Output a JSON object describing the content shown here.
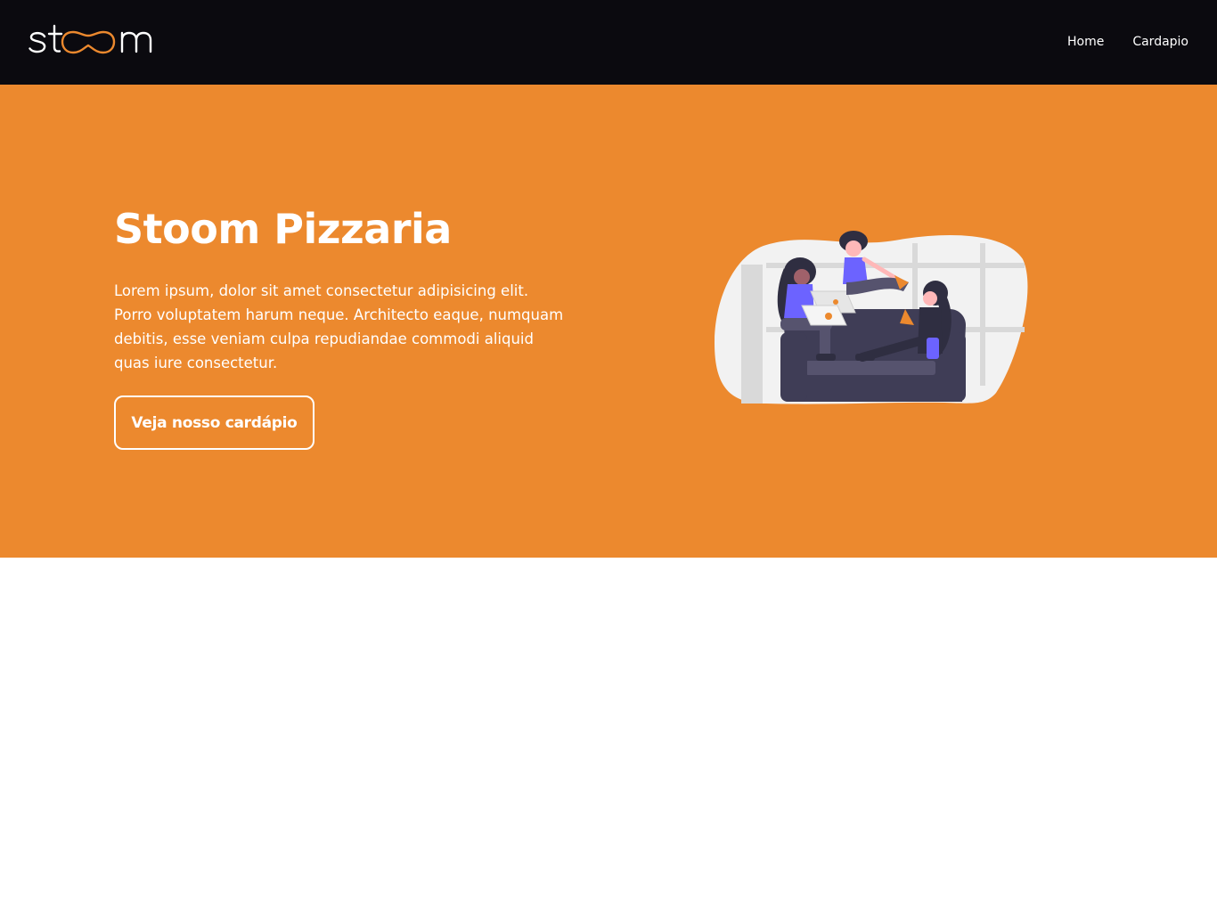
{
  "header": {
    "logo_alt": "stoom",
    "nav": [
      {
        "label": "Home"
      },
      {
        "label": "Cardapio"
      }
    ]
  },
  "hero": {
    "title": "Stoom Pizzaria",
    "description": "Lorem ipsum, dolor sit amet consectetur adipisicing elit. Porro voluptatem harum neque. Architecto eaque, numquam debitis, esse veniam culpa repudiandae commodi aliquid quas iure consectetur.",
    "cta_label": "Veja nosso cardápio"
  },
  "colors": {
    "navbar_bg": "#0b0a0f",
    "hero_bg": "#ec892e",
    "accent_purple": "#6c63ff",
    "sofa_dark": "#3f3d56"
  }
}
